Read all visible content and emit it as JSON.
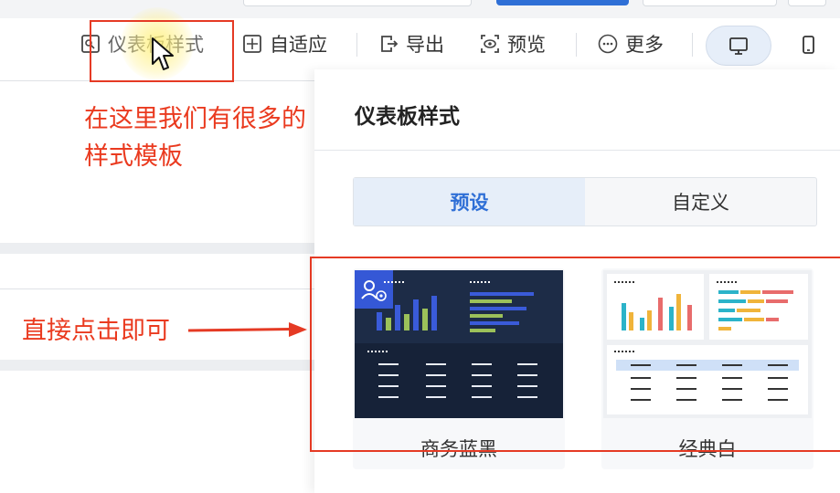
{
  "toolbar": {
    "dashboard_style": "仪表板样式",
    "auto_fit": "自适应",
    "export": "导出",
    "preview": "预览",
    "more": "更多"
  },
  "device_toggle": {
    "active": "desktop"
  },
  "panel": {
    "title": "仪表板样式",
    "tabs": [
      {
        "label": "预设",
        "active": true
      },
      {
        "label": "自定义",
        "active": false
      }
    ],
    "themes": [
      {
        "name": "商务蓝黑"
      },
      {
        "name": "经典白"
      }
    ]
  },
  "annotations": {
    "note_top_line1": "在这里我们有很多的",
    "note_top_line2": "样式模板",
    "note_left": "直接点击即可"
  },
  "colors": {
    "accent": "#2f6fd6",
    "annotation": "#e53a24",
    "dark_theme_bg": "#162238"
  }
}
